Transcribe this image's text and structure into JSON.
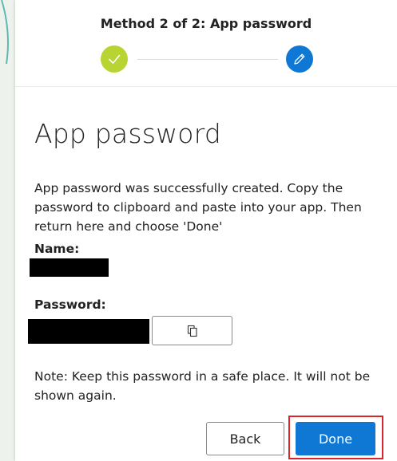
{
  "header": {
    "method_title": "Method 2 of 2: App password"
  },
  "stepper": {
    "steps": [
      {
        "state": "completed",
        "icon": "checkmark-icon",
        "color": "#b8d432"
      },
      {
        "state": "current",
        "icon": "pencil-icon",
        "color": "#0f78d4"
      }
    ]
  },
  "main": {
    "title": "App password",
    "description": "App password was successfully created. Copy the password to clipboard and paste into your app. Then return here and choose 'Done'",
    "name_label": "Name:",
    "password_label": "Password:",
    "copy_button_icon": "copy-icon",
    "note": "Note: Keep this password in a safe place. It will not be shown again."
  },
  "footer": {
    "back_label": "Back",
    "done_label": "Done"
  },
  "colors": {
    "accent": "#0f78d4",
    "success": "#b8d432",
    "highlight": "#d9262e"
  }
}
